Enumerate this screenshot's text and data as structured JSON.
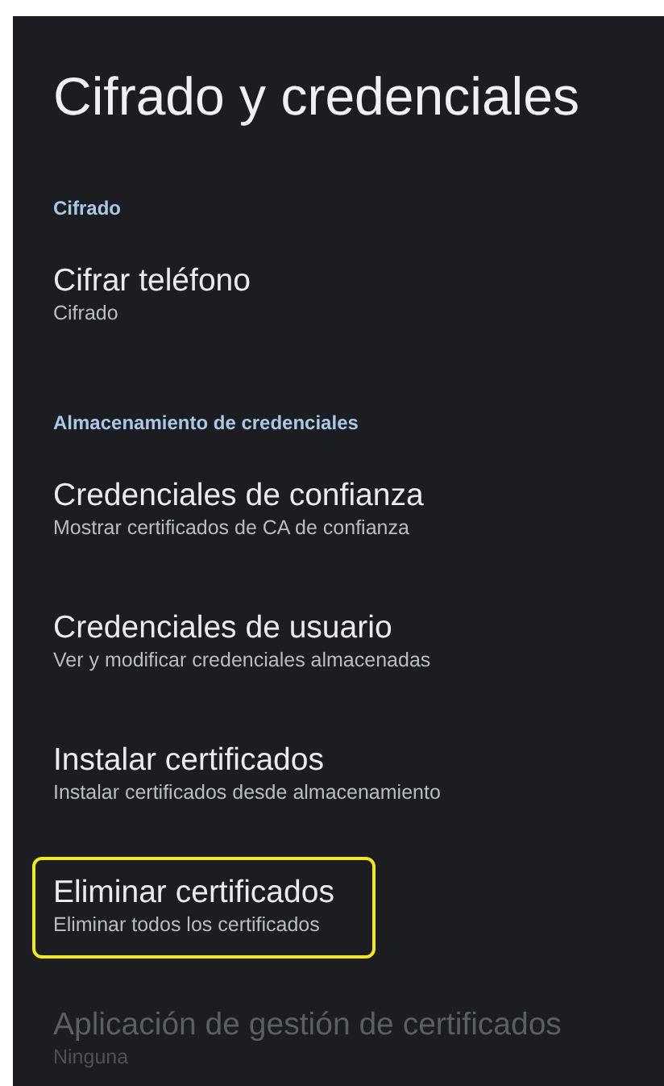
{
  "title": "Cifrado y credenciales",
  "sections": [
    {
      "header": "Cifrado",
      "items": [
        {
          "title": "Cifrar teléfono",
          "summary": "Cifrado",
          "disabled": false,
          "highlighted": false
        }
      ]
    },
    {
      "header": "Almacenamiento de credenciales",
      "items": [
        {
          "title": "Credenciales de confianza",
          "summary": "Mostrar certificados de CA de confianza",
          "disabled": false,
          "highlighted": false
        },
        {
          "title": "Credenciales de usuario",
          "summary": "Ver y modificar credenciales almacenadas",
          "disabled": false,
          "highlighted": false
        },
        {
          "title": "Instalar certificados",
          "summary": "Instalar certificados desde almacenamiento",
          "disabled": false,
          "highlighted": false
        },
        {
          "title": "Eliminar certificados",
          "summary": "Eliminar todos los certificados",
          "disabled": false,
          "highlighted": true
        },
        {
          "title": "Aplicación de gestión de certificados",
          "summary": "Ninguna",
          "disabled": true,
          "highlighted": false
        }
      ]
    }
  ]
}
